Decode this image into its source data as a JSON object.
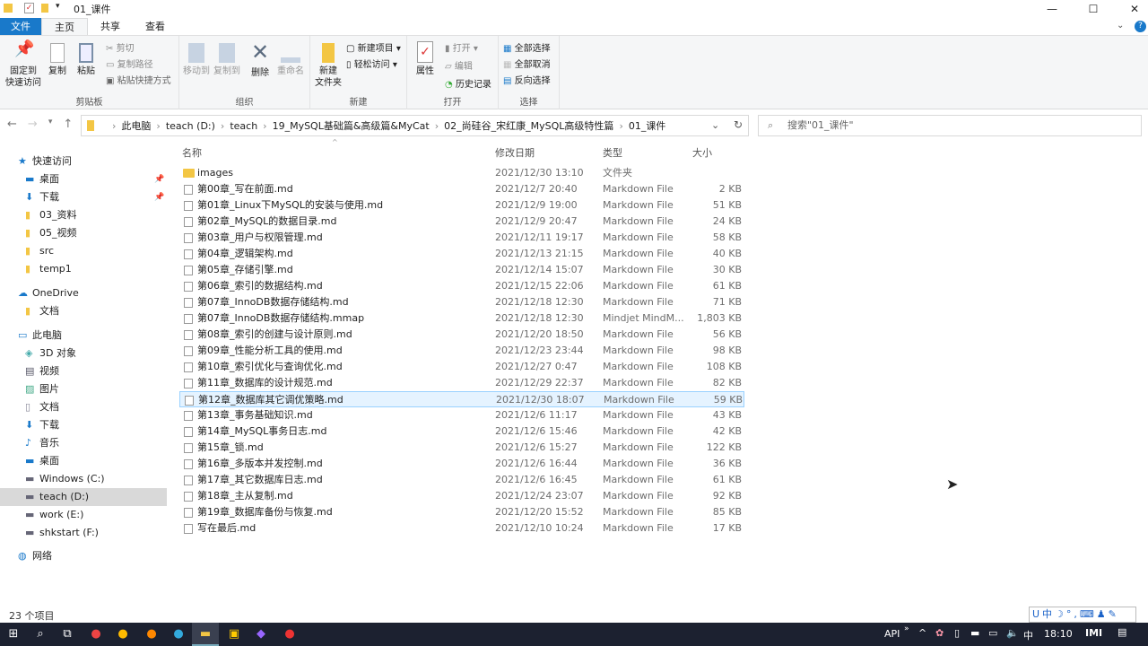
{
  "window": {
    "title": "01_课件",
    "min": "—",
    "max": "☐",
    "close": "✕"
  },
  "tabs": [
    "文件",
    "主页",
    "共享",
    "查看"
  ],
  "ribbon": {
    "clipboard": {
      "label": "剪贴板",
      "pin": "固定到\n快速访问",
      "copy": "复制",
      "paste": "粘贴",
      "cut": "剪切",
      "copy_path": "复制路径",
      "paste_shortcut": "粘贴快捷方式"
    },
    "organize": {
      "label": "组织",
      "move_to": "移动到",
      "copy_to": "复制到",
      "delete": "删除",
      "rename": "重命名"
    },
    "new": {
      "label": "新建",
      "new_folder": "新建\n文件夹",
      "new_item": "新建项目 ▾",
      "easy_access": "轻松访问 ▾"
    },
    "open": {
      "label": "打开",
      "properties": "属性",
      "open": "打开 ▾",
      "edit": "编辑",
      "history": "历史记录"
    },
    "select": {
      "label": "选择",
      "select_all": "全部选择",
      "select_none": "全部取消",
      "invert": "反向选择"
    }
  },
  "address": {
    "crumbs": [
      "此电脑",
      "teach (D:)",
      "teach",
      "19_MySQL基础篇&高级篇&MyCat",
      "02_尚硅谷_宋红康_MySQL高级特性篇",
      "01_课件"
    ],
    "search_placeholder": "搜索\"01_课件\""
  },
  "sidebar": [
    {
      "label": "快速访问",
      "icon": "star"
    },
    {
      "label": "桌面",
      "icon": "desktop",
      "pinned": true
    },
    {
      "label": "下载",
      "icon": "download",
      "pinned": true
    },
    {
      "label": "03_资料",
      "icon": "folder"
    },
    {
      "label": "05_视频",
      "icon": "folder"
    },
    {
      "label": "src",
      "icon": "folder"
    },
    {
      "label": "temp1",
      "icon": "folder"
    },
    {
      "label": "OneDrive",
      "icon": "cloud"
    },
    {
      "label": "文档",
      "icon": "folder"
    },
    {
      "label": "此电脑",
      "icon": "pc"
    },
    {
      "label": "3D 对象",
      "icon": "cube"
    },
    {
      "label": "视频",
      "icon": "video"
    },
    {
      "label": "图片",
      "icon": "picture"
    },
    {
      "label": "文档",
      "icon": "document"
    },
    {
      "label": "下载",
      "icon": "download"
    },
    {
      "label": "音乐",
      "icon": "music"
    },
    {
      "label": "桌面",
      "icon": "desktop"
    },
    {
      "label": "Windows (C:)",
      "icon": "drive"
    },
    {
      "label": "teach (D:)",
      "icon": "drive",
      "selected": true
    },
    {
      "label": "work (E:)",
      "icon": "drive"
    },
    {
      "label": "shkstart (F:)",
      "icon": "drive"
    },
    {
      "label": "网络",
      "icon": "network"
    }
  ],
  "columns": {
    "name": "名称",
    "date": "修改日期",
    "type": "类型",
    "size": "大小"
  },
  "files": [
    {
      "name": "images",
      "date": "2021/12/30 13:10",
      "type": "文件夹",
      "size": "",
      "folder": true
    },
    {
      "name": "第00章_写在前面.md",
      "date": "2021/12/7 20:40",
      "type": "Markdown File",
      "size": "2 KB"
    },
    {
      "name": "第01章_Linux下MySQL的安装与使用.md",
      "date": "2021/12/9 19:00",
      "type": "Markdown File",
      "size": "51 KB"
    },
    {
      "name": "第02章_MySQL的数据目录.md",
      "date": "2021/12/9 20:47",
      "type": "Markdown File",
      "size": "24 KB"
    },
    {
      "name": "第03章_用户与权限管理.md",
      "date": "2021/12/11 19:17",
      "type": "Markdown File",
      "size": "58 KB"
    },
    {
      "name": "第04章_逻辑架构.md",
      "date": "2021/12/13 21:15",
      "type": "Markdown File",
      "size": "40 KB"
    },
    {
      "name": "第05章_存储引擎.md",
      "date": "2021/12/14 15:07",
      "type": "Markdown File",
      "size": "30 KB"
    },
    {
      "name": "第06章_索引的数据结构.md",
      "date": "2021/12/15 22:06",
      "type": "Markdown File",
      "size": "61 KB"
    },
    {
      "name": "第07章_InnoDB数据存储结构.md",
      "date": "2021/12/18 12:30",
      "type": "Markdown File",
      "size": "71 KB"
    },
    {
      "name": "第07章_InnoDB数据存储结构.mmap",
      "date": "2021/12/18 12:30",
      "type": "Mindjet MindM...",
      "size": "1,803 KB"
    },
    {
      "name": "第08章_索引的创建与设计原则.md",
      "date": "2021/12/20 18:50",
      "type": "Markdown File",
      "size": "56 KB"
    },
    {
      "name": "第09章_性能分析工具的使用.md",
      "date": "2021/12/23 23:44",
      "type": "Markdown File",
      "size": "98 KB"
    },
    {
      "name": "第10章_索引优化与查询优化.md",
      "date": "2021/12/27 0:47",
      "type": "Markdown File",
      "size": "108 KB"
    },
    {
      "name": "第11章_数据库的设计规范.md",
      "date": "2021/12/29 22:37",
      "type": "Markdown File",
      "size": "82 KB"
    },
    {
      "name": "第12章_数据库其它调优策略.md",
      "date": "2021/12/30 18:07",
      "type": "Markdown File",
      "size": "59 KB",
      "hover": true
    },
    {
      "name": "第13章_事务基础知识.md",
      "date": "2021/12/6 11:17",
      "type": "Markdown File",
      "size": "43 KB"
    },
    {
      "name": "第14章_MySQL事务日志.md",
      "date": "2021/12/6 15:46",
      "type": "Markdown File",
      "size": "42 KB"
    },
    {
      "name": "第15章_锁.md",
      "date": "2021/12/6 15:27",
      "type": "Markdown File",
      "size": "122 KB"
    },
    {
      "name": "第16章_多版本并发控制.md",
      "date": "2021/12/6 16:44",
      "type": "Markdown File",
      "size": "36 KB"
    },
    {
      "name": "第17章_其它数据库日志.md",
      "date": "2021/12/6 16:45",
      "type": "Markdown File",
      "size": "61 KB"
    },
    {
      "name": "第18章_主从复制.md",
      "date": "2021/12/24 23:07",
      "type": "Markdown File",
      "size": "92 KB"
    },
    {
      "name": "第19章_数据库备份与恢复.md",
      "date": "2021/12/20 15:52",
      "type": "Markdown File",
      "size": "85 KB"
    },
    {
      "name": "写在最后.md",
      "date": "2021/12/10 10:24",
      "type": "Markdown File",
      "size": "17 KB"
    }
  ],
  "status": "23 个项目",
  "ime": "U中☽°,⌨♟✎",
  "taskbar": {
    "api": "API",
    "ime": "中",
    "time": "18:10"
  }
}
